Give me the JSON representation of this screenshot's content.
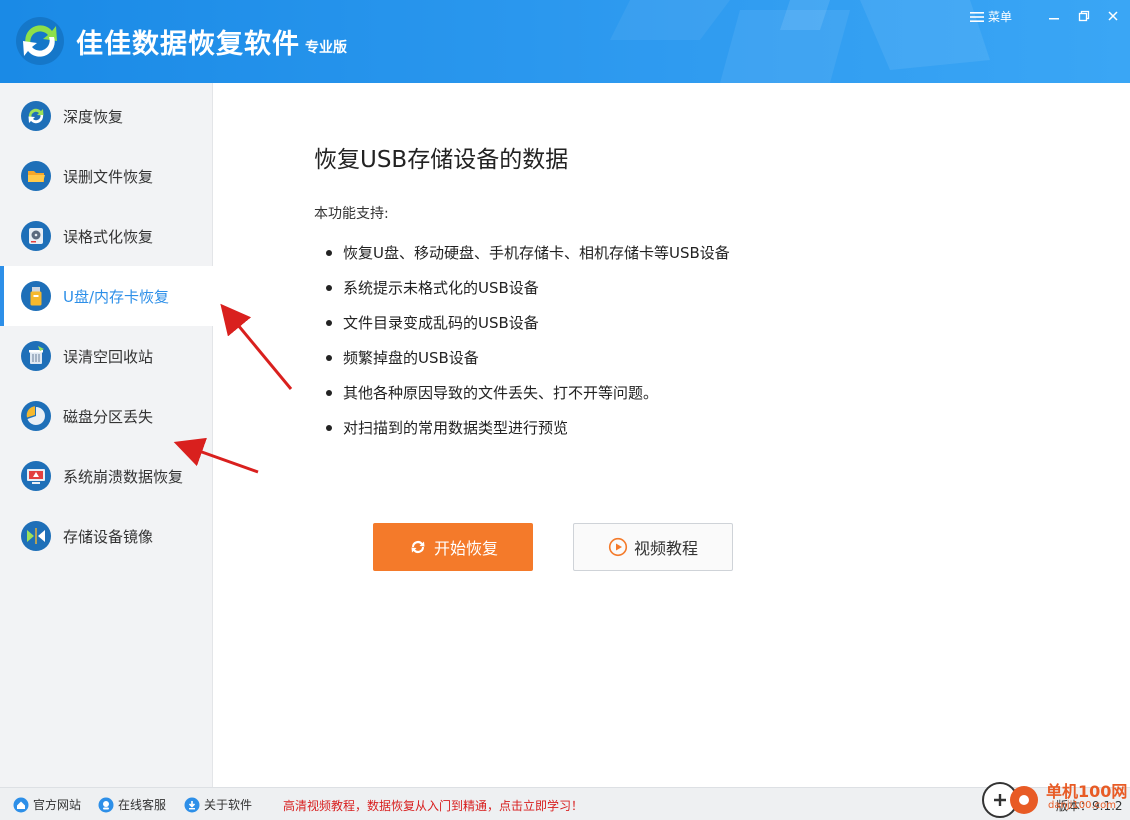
{
  "header": {
    "title": "佳佳数据恢复软件",
    "edition": "专业版",
    "menu_label": "菜单"
  },
  "sidebar": {
    "items": [
      {
        "label": "深度恢复",
        "icon": "refresh-icon"
      },
      {
        "label": "误删文件恢复",
        "icon": "folder-icon"
      },
      {
        "label": "误格式化恢复",
        "icon": "disk-icon"
      },
      {
        "label": "U盘/内存卡恢复",
        "icon": "usb-drive-icon",
        "active": true
      },
      {
        "label": "误清空回收站",
        "icon": "recycle-bin-icon"
      },
      {
        "label": "磁盘分区丢失",
        "icon": "pie-partition-icon"
      },
      {
        "label": "系统崩溃数据恢复",
        "icon": "crashed-monitor-icon"
      },
      {
        "label": "存储设备镜像",
        "icon": "device-mirror-icon"
      }
    ]
  },
  "main": {
    "title": "恢复USB存储设备的数据",
    "support_label": "本功能支持:",
    "features": [
      "恢复U盘、移动硬盘、手机存储卡、相机存储卡等USB设备",
      "系统提示未格式化的USB设备",
      "文件目录变成乱码的USB设备",
      "频繁掉盘的USB设备",
      "其他各种原因导致的文件丢失、打不开等问题。",
      "对扫描到的常用数据类型进行预览"
    ],
    "start_button": "开始恢复",
    "video_button": "视频教程"
  },
  "footer": {
    "website": "官方网站",
    "support": "在线客服",
    "about": "关于软件",
    "promo": "高清视频教程，数据恢复从入门到精通，点击立即学习！",
    "version": "版本：9.1.2"
  },
  "watermark": {
    "name": "单机100网",
    "url": "danji100.com"
  },
  "colors": {
    "header_blue": "#2f9bf0",
    "accent_blue": "#2d8fe8",
    "start_orange": "#f47a2a",
    "promo_red": "#d81e1e",
    "arrow_red": "#d9201e"
  }
}
